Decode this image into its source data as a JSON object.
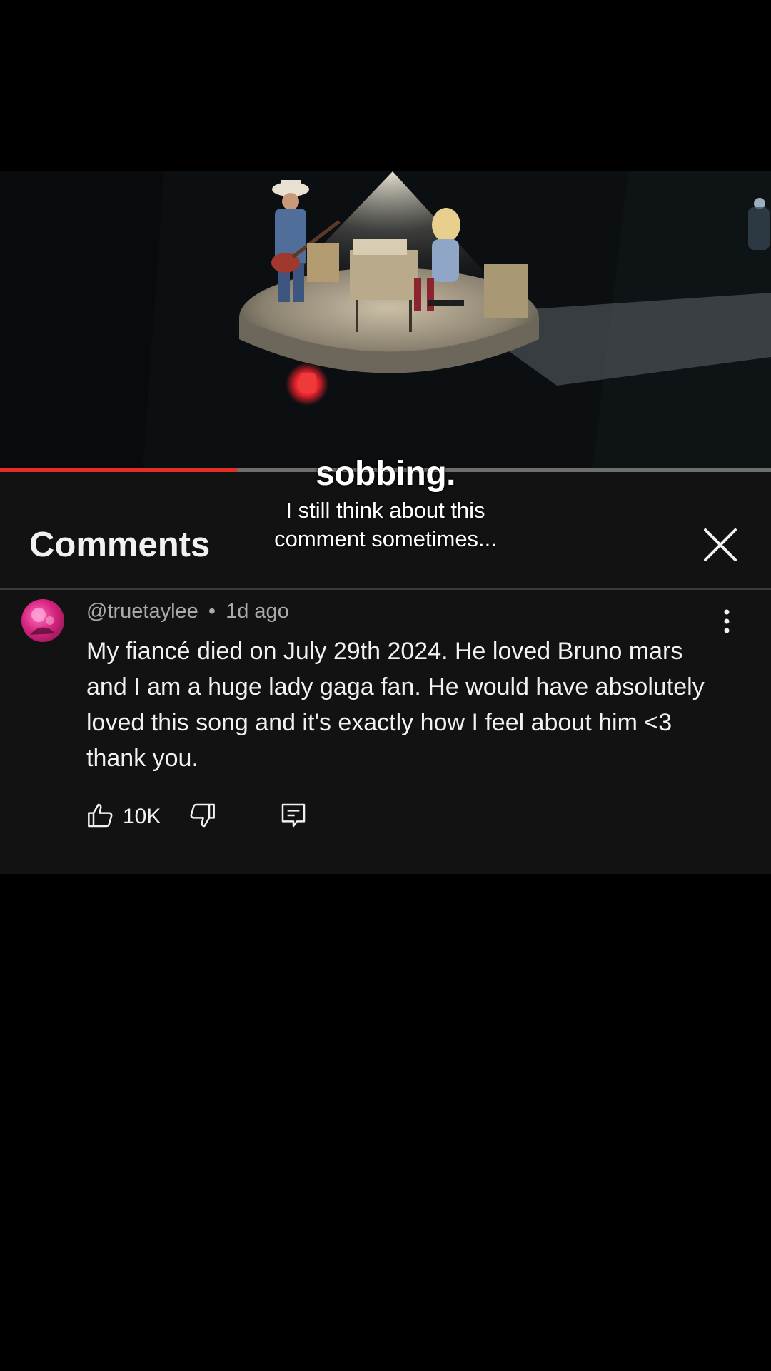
{
  "overlay": {
    "caption_main": "sobbing.",
    "caption_line1": "I still think about this",
    "caption_line2": "comment sometimes..."
  },
  "player": {
    "progress_fraction": 0.307,
    "progress_color": "#e52d27"
  },
  "comments_panel": {
    "title": "Comments",
    "close_icon": "close-icon"
  },
  "comment": {
    "author": "@truetaylee",
    "separator": "•",
    "time": "1d ago",
    "text": "My fiancé died on July 29th 2024. He loved Bruno mars and I am a huge lady gaga fan. He would have absolutely loved this song and it's exactly how I feel about him <3 thank you.",
    "like_count": "10K",
    "icons": [
      "thumbs-up-icon",
      "thumbs-down-icon",
      "reply-icon",
      "more-vert-icon"
    ]
  }
}
